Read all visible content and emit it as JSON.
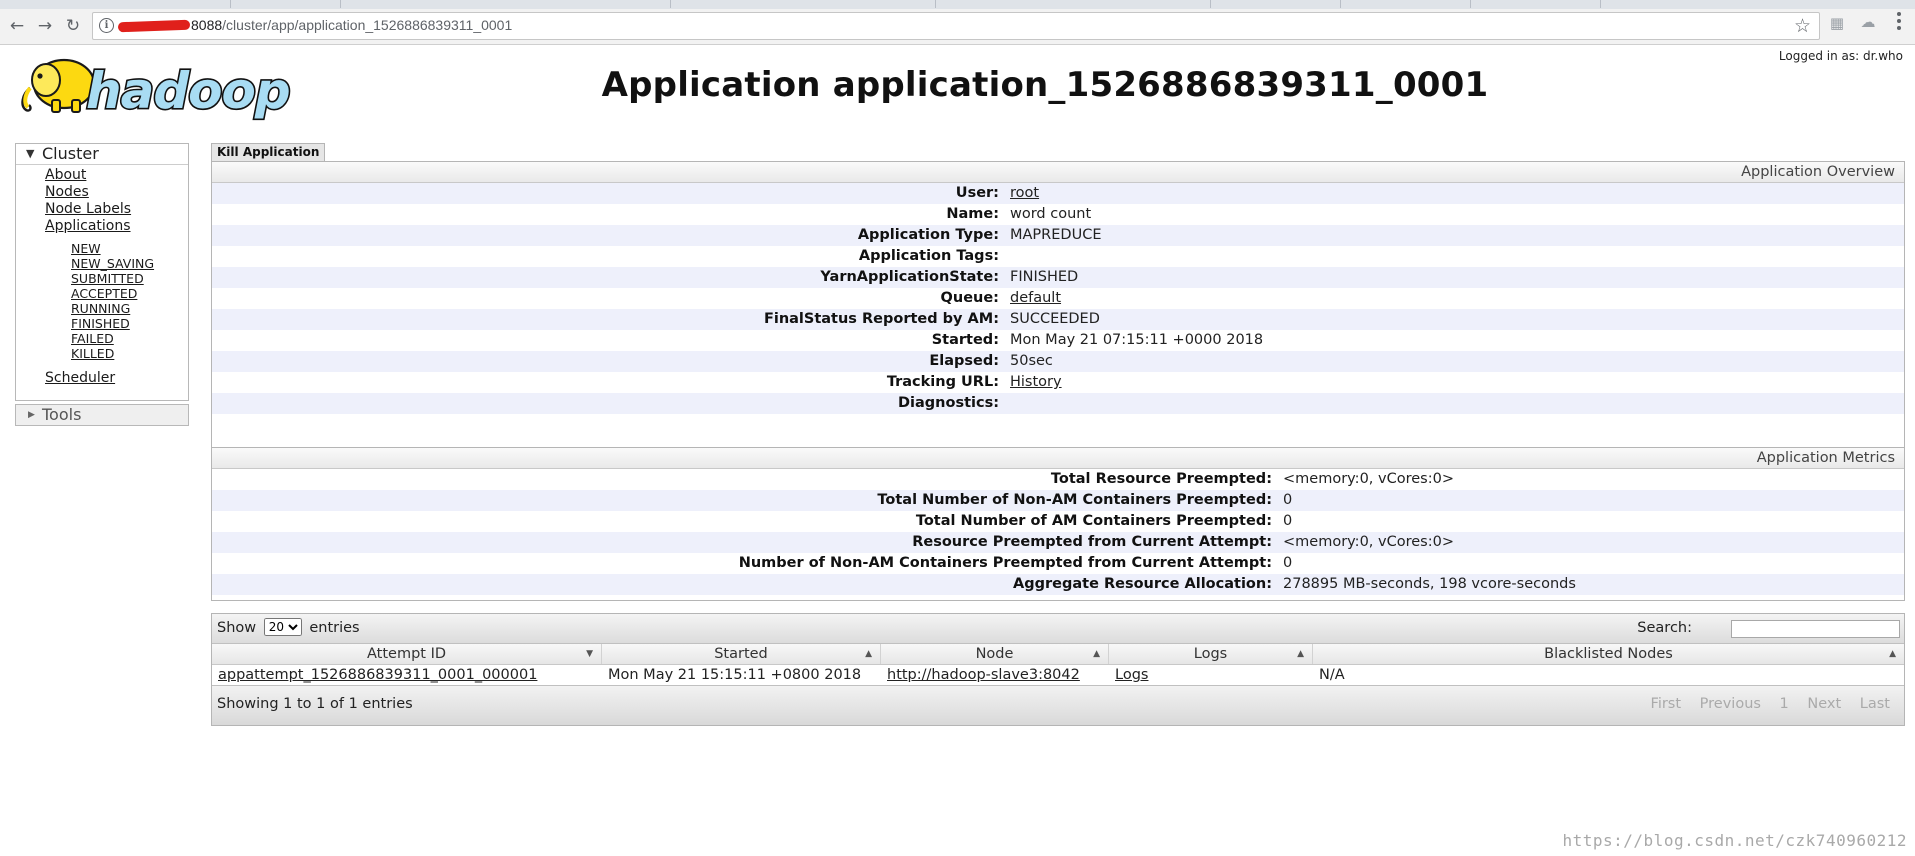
{
  "browser": {
    "url_host": "8088",
    "url_path": "/cluster/app/application_1526886839311_0001"
  },
  "header": {
    "logged_in": "Logged in as: dr.who",
    "logo_text": "hadoop",
    "title": "Application application_1526886839311_0001"
  },
  "sidebar": {
    "cluster_label": "Cluster",
    "links": [
      "About",
      "Nodes",
      "Node Labels",
      "Applications"
    ],
    "app_states": [
      "NEW",
      "NEW_SAVING",
      "SUBMITTED",
      "ACCEPTED",
      "RUNNING",
      "FINISHED",
      "FAILED",
      "KILLED"
    ],
    "scheduler": "Scheduler",
    "tools_label": "Tools"
  },
  "kill_button": "Kill Application",
  "overview": {
    "header": "Application Overview",
    "rows": [
      {
        "k": "User:",
        "v": "root"
      },
      {
        "k": "Name:",
        "v": "word count"
      },
      {
        "k": "Application Type:",
        "v": "MAPREDUCE"
      },
      {
        "k": "Application Tags:",
        "v": ""
      },
      {
        "k": "YarnApplicationState:",
        "v": "FINISHED"
      },
      {
        "k": "Queue:",
        "v": "default"
      },
      {
        "k": "FinalStatus Reported by AM:",
        "v": "SUCCEEDED"
      },
      {
        "k": "Started:",
        "v": "Mon May 21 07:15:11 +0000 2018"
      },
      {
        "k": "Elapsed:",
        "v": "50sec"
      },
      {
        "k": "Tracking URL:",
        "v": "History"
      },
      {
        "k": "Diagnostics:",
        "v": ""
      }
    ]
  },
  "metrics": {
    "header": "Application Metrics",
    "rows": [
      {
        "k": "Total Resource Preempted:",
        "v": "<memory:0, vCores:0>"
      },
      {
        "k": "Total Number of Non-AM Containers Preempted:",
        "v": "0"
      },
      {
        "k": "Total Number of AM Containers Preempted:",
        "v": "0"
      },
      {
        "k": "Resource Preempted from Current Attempt:",
        "v": "<memory:0, vCores:0>"
      },
      {
        "k": "Number of Non-AM Containers Preempted from Current Attempt:",
        "v": "0"
      },
      {
        "k": "Aggregate Resource Allocation:",
        "v": "278895 MB-seconds, 198 vcore-seconds"
      }
    ]
  },
  "attempts": {
    "show_label": "Show",
    "show_value": "20",
    "entries_label": "entries",
    "search_label": "Search:",
    "columns": [
      "Attempt ID",
      "Started",
      "Node",
      "Logs",
      "Blacklisted Nodes"
    ],
    "rows": [
      {
        "attempt_id": "appattempt_1526886839311_0001_000001",
        "started": "Mon May 21 15:15:11 +0800 2018",
        "node": "http://hadoop-slave3:8042",
        "logs": "Logs",
        "blacklisted": "N/A"
      }
    ],
    "footer_info": "Showing 1 to 1 of 1 entries",
    "pager": {
      "first": "First",
      "previous": "Previous",
      "page": "1",
      "next": "Next",
      "last": "Last"
    }
  },
  "watermark": "https://blog.csdn.net/czk740960212"
}
